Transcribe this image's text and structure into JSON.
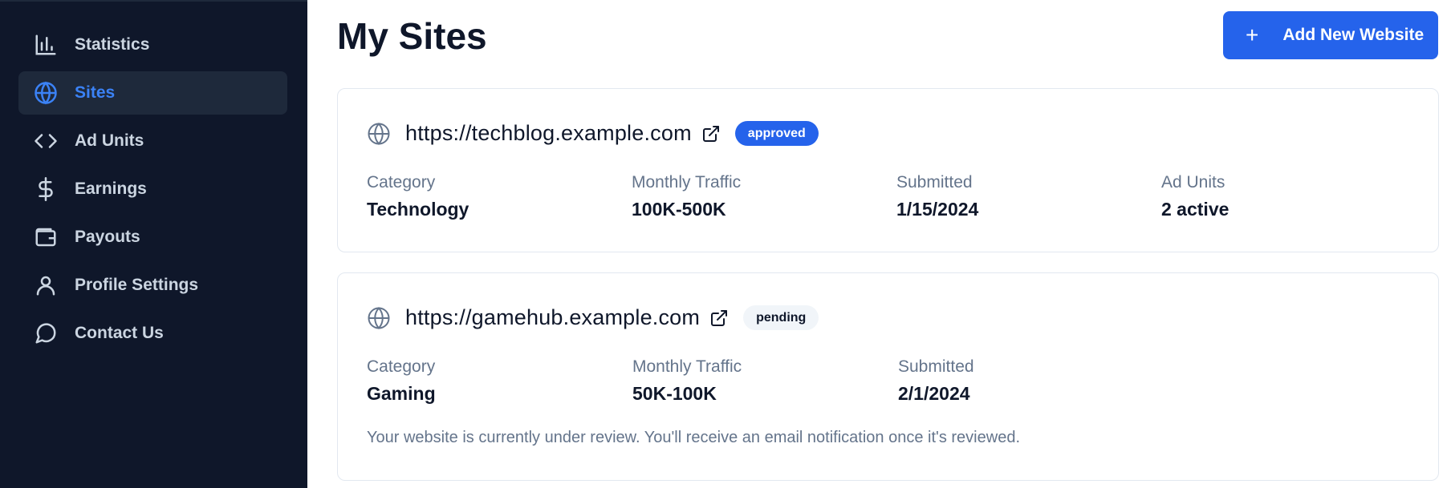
{
  "sidebar": {
    "items": [
      {
        "label": "Statistics",
        "icon": "bar-chart-icon",
        "active": false
      },
      {
        "label": "Sites",
        "icon": "globe-icon",
        "active": true
      },
      {
        "label": "Ad Units",
        "icon": "code-icon",
        "active": false
      },
      {
        "label": "Earnings",
        "icon": "dollar-icon",
        "active": false
      },
      {
        "label": "Payouts",
        "icon": "wallet-icon",
        "active": false
      },
      {
        "label": "Profile Settings",
        "icon": "user-icon",
        "active": false
      },
      {
        "label": "Contact Us",
        "icon": "message-circle-icon",
        "active": false
      }
    ]
  },
  "header": {
    "title": "My Sites",
    "add_button_icon": "+",
    "add_button_label": "Add New Website"
  },
  "sites": [
    {
      "url": "https://techblog.example.com",
      "status": "approved",
      "stats": [
        {
          "label": "Category",
          "value": "Technology"
        },
        {
          "label": "Monthly Traffic",
          "value": "100K-500K"
        },
        {
          "label": "Submitted",
          "value": "1/15/2024"
        },
        {
          "label": "Ad Units",
          "value": "2 active"
        }
      ]
    },
    {
      "url": "https://gamehub.example.com",
      "status": "pending",
      "stats": [
        {
          "label": "Category",
          "value": "Gaming"
        },
        {
          "label": "Monthly Traffic",
          "value": "50K-100K"
        },
        {
          "label": "Submitted",
          "value": "2/1/2024"
        }
      ],
      "note": "Your website is currently under review. You'll receive an email notification once it's reviewed."
    }
  ],
  "colors": {
    "sidebar_bg": "#0f172a",
    "active_item_bg": "#1e293b",
    "accent": "#2563eb",
    "active_text": "#3b82f6"
  }
}
